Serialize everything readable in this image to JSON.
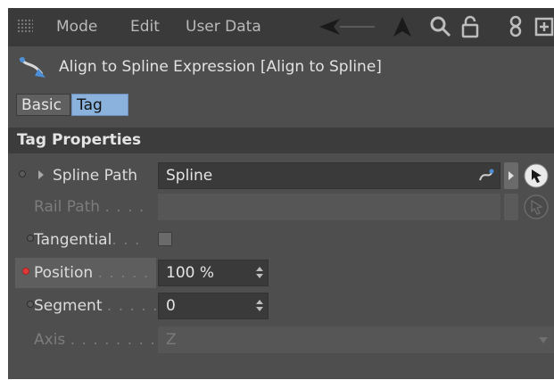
{
  "menubar": {
    "items": [
      "Mode",
      "Edit",
      "User Data"
    ],
    "icons": [
      "back-arrow-icon",
      "up-arrow-icon",
      "search-icon",
      "lock-icon",
      "link-icon",
      "new-window-icon"
    ]
  },
  "title": {
    "text": "Align to Spline Expression [Align to Spline]",
    "icon": "align-to-spline-icon"
  },
  "tabs": [
    {
      "label": "Basic",
      "active": false
    },
    {
      "label": "Tag",
      "active": true
    }
  ],
  "section": {
    "title": "Tag Properties"
  },
  "properties": {
    "spline_path": {
      "label": "Spline Path",
      "value": "Spline"
    },
    "rail_path": {
      "label": "Rail Path",
      "dots": ". . . .",
      "value": ""
    },
    "tangential": {
      "label": "Tangential",
      "dots": ". . .",
      "checked": false
    },
    "position": {
      "label": "Position",
      "dots": ". . . . .",
      "value": "100 %",
      "animated": true
    },
    "segment": {
      "label": "Segment",
      "dots": ". . . . .",
      "value": "0"
    },
    "axis": {
      "label": "Axis",
      "dots": ". . . . . . . .",
      "value": "Z"
    }
  },
  "colors": {
    "active_tab": "#8ab2dc",
    "keyframe_dot": "#e03a3a",
    "panel_bg": "#4e4e4e"
  }
}
